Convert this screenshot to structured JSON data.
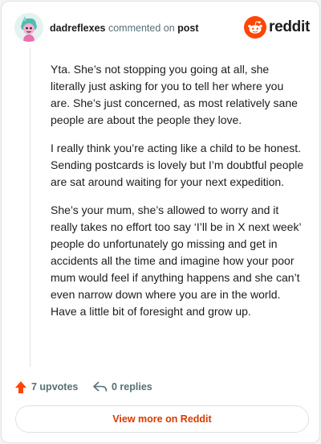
{
  "header": {
    "username": "dadreflexes",
    "commented_on_text": "commented on",
    "post_link": "post",
    "brand": "reddit"
  },
  "comment": {
    "paragraphs": [
      "Yta. She’s not stopping you going at all, she literally just asking for you to tell her where you are. She’s just concerned, as most relatively sane people are about the people they love.",
      "I really think you’re acting like a child to be honest. Sending postcards is lovely but I’m doubtful people are sat around waiting for your next expedition.",
      "She’s your mum, she’s allowed to worry and it really takes no effort too say ‘I’ll be in X next week’ people do unfortunately go missing and get in accidents all the time and imagine how your poor mum would feel if anything happens and she can’t even narrow down where you are in the world. Have a little bit of foresight and grow up."
    ]
  },
  "actions": {
    "upvotes": "7 upvotes",
    "replies": "0 replies"
  },
  "footer": {
    "view_more": "View more on Reddit"
  },
  "colors": {
    "brand": "#ff4500",
    "upvote": "#ff4500",
    "link": "#d93a00",
    "muted": "#576f76"
  }
}
